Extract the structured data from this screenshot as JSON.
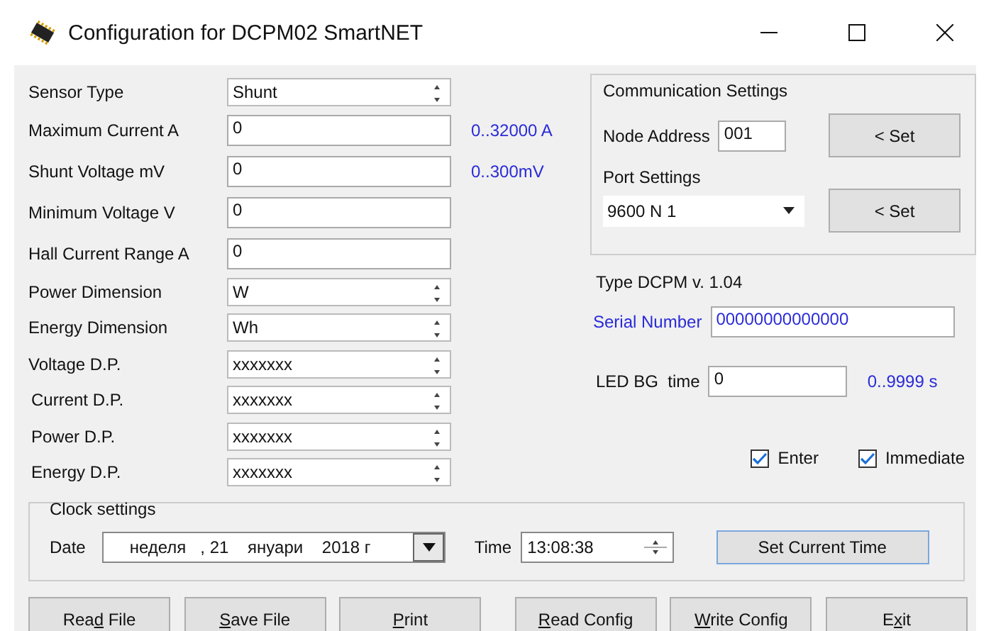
{
  "window": {
    "title": "Configuration for DCPM02 SmartNET"
  },
  "fields": [
    {
      "label": "Sensor Type",
      "kind": "spin",
      "value": "Shunt"
    },
    {
      "label": "Maximum Current A",
      "kind": "text",
      "value": "0",
      "range": "0..32000 A"
    },
    {
      "label": "Shunt Voltage mV",
      "kind": "text",
      "value": "0",
      "range": "0..300mV"
    },
    {
      "label": "Minimum Voltage V",
      "kind": "text",
      "value": "0"
    },
    {
      "label": "Hall Current Range A",
      "kind": "text",
      "value": "0"
    },
    {
      "label": "Power Dimension",
      "kind": "spin",
      "value": "W"
    },
    {
      "label": "Energy Dimension",
      "kind": "spin",
      "value": "Wh"
    },
    {
      "label": "Voltage D.P.",
      "kind": "spin",
      "value": "xxxxxxx"
    },
    {
      "label": "Current D.P.",
      "kind": "spin",
      "value": "xxxxxxx"
    },
    {
      "label": "Power D.P.",
      "kind": "spin",
      "value": "xxxxxxx"
    },
    {
      "label": "Energy D.P.",
      "kind": "spin",
      "value": "xxxxxxx"
    }
  ],
  "communication": {
    "title": "Communication Settings",
    "node_label": "Node Address",
    "node_value": "001",
    "node_button": "< Set",
    "port_label": "Port Settings",
    "port_value": "9600 N 1",
    "port_button": "< Set"
  },
  "type_text": "Type DCPM v. 1.04",
  "serial": {
    "label": "Serial Number",
    "value": "00000000000000"
  },
  "led": {
    "label": "LED BG  time",
    "value": "0",
    "range": "0..9999 s"
  },
  "checkboxes": [
    {
      "label": "Enter",
      "checked": true
    },
    {
      "label": "Immediate",
      "checked": true
    }
  ],
  "clock": {
    "title": "Clock settings",
    "date_label": "Date",
    "date_value": "неделя   , 21    януари    2018 г",
    "time_label": "Time",
    "time_value": "13:08:38",
    "button": "Set Current Time"
  },
  "buttons": [
    {
      "before": "Rea",
      "key": "d",
      "after": " File"
    },
    {
      "key": "S",
      "after": "ave File"
    },
    {
      "key": "P",
      "after": "rint"
    },
    {
      "key": "R",
      "after": "ead Config"
    },
    {
      "key": "W",
      "after": "rite Config"
    },
    {
      "before": "E",
      "key": "x",
      "after": "it"
    }
  ]
}
